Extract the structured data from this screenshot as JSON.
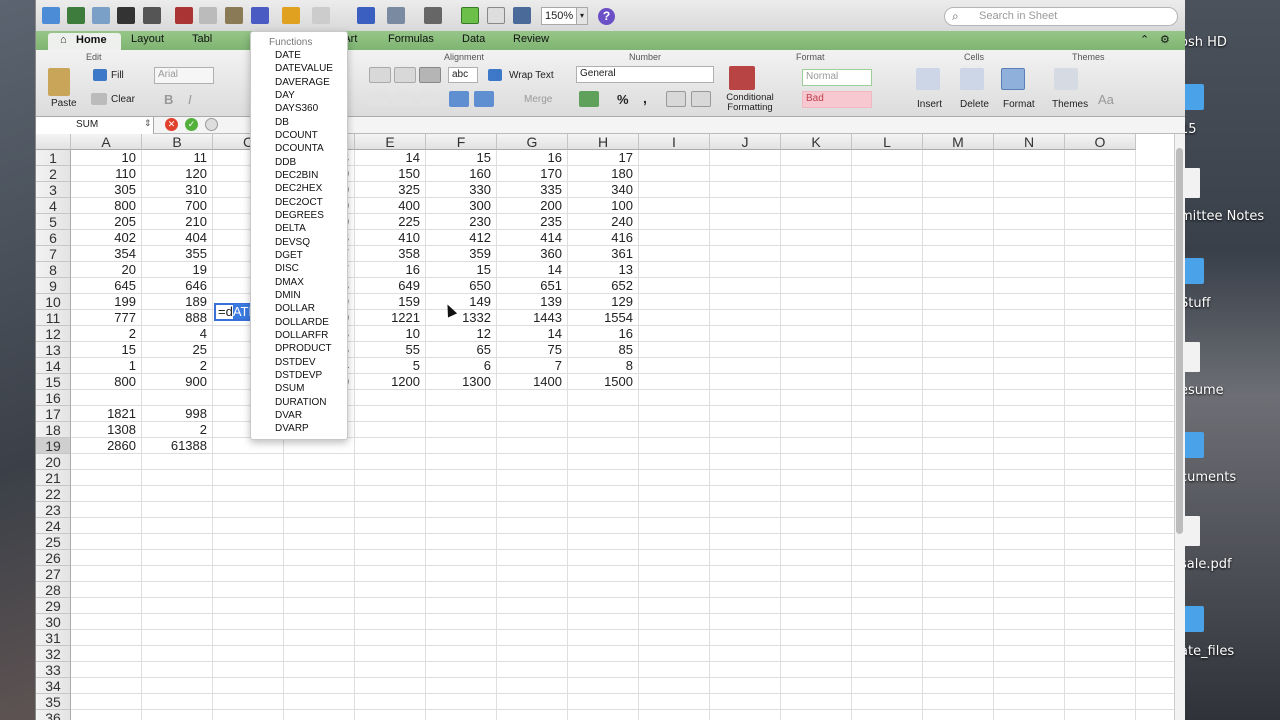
{
  "toolbar": {
    "zoom": "150%",
    "search_placeholder": "Search in Sheet",
    "help": "?"
  },
  "tabs": [
    "Home",
    "Layout",
    "Tabl",
    "SmartArt",
    "Formulas",
    "Data",
    "Review"
  ],
  "ribbon": {
    "groups": [
      "Edit",
      "Font",
      "Alignment",
      "Number",
      "Format",
      "Cells",
      "Themes"
    ],
    "paste": "Paste",
    "fill": "Fill",
    "clear": "Clear",
    "font": "Arial",
    "bold": "B",
    "italic": "I",
    "wrap_text": "Wrap Text",
    "merge": "Merge",
    "abc": "abc",
    "number_format": "General",
    "percent": "%",
    "comma": ",",
    "conditional_formatting": "Conditional Formatting",
    "style_normal": "Normal",
    "style_bad": "Bad",
    "insert": "Insert",
    "delete": "Delete",
    "format": "Format",
    "themes": "Themes",
    "aa": "Aa"
  },
  "formula_bar": {
    "name_box": "SUM"
  },
  "functions_menu": {
    "title": "Functions",
    "items": [
      "DATE",
      "DATEVALUE",
      "DAVERAGE",
      "DAY",
      "DAYS360",
      "DB",
      "DCOUNT",
      "DCOUNTA",
      "DDB",
      "DEC2BIN",
      "DEC2HEX",
      "DEC2OCT",
      "DEGREES",
      "DELTA",
      "DEVSQ",
      "DGET",
      "DISC",
      "DMAX",
      "DMIN",
      "DOLLAR",
      "DOLLARDE",
      "DOLLARFR",
      "DPRODUCT",
      "DSTDEV",
      "DSTDEVP",
      "DSUM",
      "DURATION",
      "DVAR",
      "DVARP"
    ]
  },
  "sheet": {
    "columns": [
      "A",
      "B",
      "C",
      "D",
      "E",
      "F",
      "G",
      "H",
      "I",
      "J",
      "K",
      "L",
      "M",
      "N",
      "O"
    ],
    "rows": [
      "1",
      "2",
      "3",
      "4",
      "5",
      "6",
      "7",
      "8",
      "9",
      "10",
      "11",
      "12",
      "13",
      "14",
      "15",
      "16",
      "17",
      "18",
      "19",
      "20",
      "21",
      "22",
      "23",
      "24",
      "25",
      "26",
      "27",
      "28",
      "29",
      "30",
      "31",
      "32",
      "33",
      "34",
      "35",
      "36"
    ],
    "cells": {
      "A": [
        "10",
        "110",
        "305",
        "800",
        "205",
        "402",
        "354",
        "20",
        "645",
        "199",
        "777",
        "2",
        "15",
        "1",
        "800",
        "",
        "1821",
        "1308",
        "2860"
      ],
      "B": [
        "11",
        "120",
        "310",
        "700",
        "210",
        "404",
        "355",
        "19",
        "646",
        "189",
        "888",
        "4",
        "25",
        "2",
        "900",
        "",
        "998",
        "2",
        "61388"
      ],
      "D": [
        "13",
        "140",
        "320",
        "500",
        "220",
        "408",
        "357",
        "17",
        "648",
        "169",
        "1110",
        "8",
        "45",
        "4",
        "1100"
      ],
      "E": [
        "14",
        "150",
        "325",
        "400",
        "225",
        "410",
        "358",
        "16",
        "649",
        "159",
        "1221",
        "10",
        "55",
        "5",
        "1200"
      ],
      "F": [
        "15",
        "160",
        "330",
        "300",
        "230",
        "412",
        "359",
        "15",
        "650",
        "149",
        "1332",
        "12",
        "65",
        "6",
        "1300"
      ],
      "G": [
        "16",
        "170",
        "335",
        "200",
        "235",
        "414",
        "360",
        "14",
        "651",
        "139",
        "1443",
        "14",
        "75",
        "7",
        "1400"
      ],
      "H": [
        "17",
        "180",
        "340",
        "100",
        "240",
        "416",
        "361",
        "13",
        "652",
        "129",
        "1554",
        "16",
        "85",
        "8",
        "1500"
      ]
    },
    "active_cell_prefix": "=d",
    "active_cell_completion": "ATE"
  },
  "desktop": {
    "labels": [
      "osh HD",
      "15",
      "mittee  Notes",
      "Stuff",
      "esume",
      "cuments",
      "sale.pdf",
      "ate_files"
    ]
  }
}
